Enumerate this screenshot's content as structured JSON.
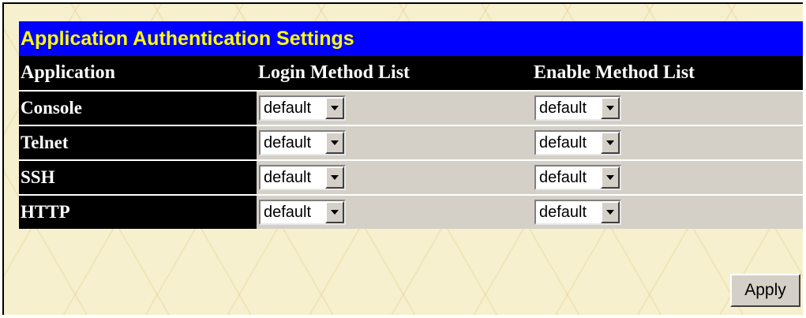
{
  "title": "Application Authentication Settings",
  "columns": {
    "application": "Application",
    "login_method_list": "Login Method List",
    "enable_method_list": "Enable Method List"
  },
  "rows": [
    {
      "application": "Console",
      "login": "default",
      "enable": "default"
    },
    {
      "application": "Telnet",
      "login": "default",
      "enable": "default"
    },
    {
      "application": "SSH",
      "login": "default",
      "enable": "default"
    },
    {
      "application": "HTTP",
      "login": "default",
      "enable": "default"
    }
  ],
  "apply_label": "Apply",
  "icons": {
    "dropdown": "chevron-down-icon"
  },
  "colors": {
    "title_background": "#0000ff",
    "title_text": "#ffff00",
    "header_background": "#000000",
    "label_cell_background": "#000000",
    "value_cell_background": "#d4d0c8",
    "page_background": "#f7f0cf"
  }
}
